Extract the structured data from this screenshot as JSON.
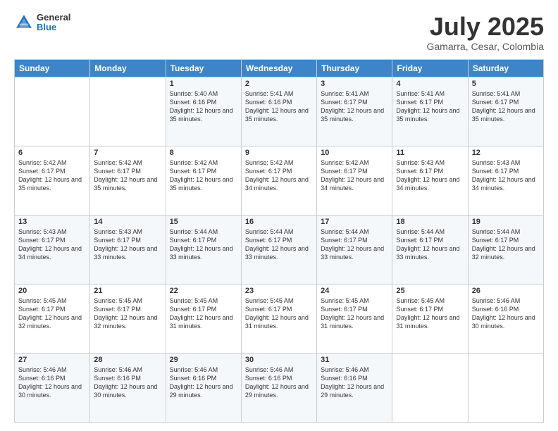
{
  "header": {
    "logo_general": "General",
    "logo_blue": "Blue",
    "month_title": "July 2025",
    "subtitle": "Gamarra, Cesar, Colombia"
  },
  "days_of_week": [
    "Sunday",
    "Monday",
    "Tuesday",
    "Wednesday",
    "Thursday",
    "Friday",
    "Saturday"
  ],
  "weeks": [
    [
      {
        "day": "",
        "sunrise": "",
        "sunset": "",
        "daylight": ""
      },
      {
        "day": "",
        "sunrise": "",
        "sunset": "",
        "daylight": ""
      },
      {
        "day": "1",
        "sunrise": "Sunrise: 5:40 AM",
        "sunset": "Sunset: 6:16 PM",
        "daylight": "Daylight: 12 hours and 35 minutes."
      },
      {
        "day": "2",
        "sunrise": "Sunrise: 5:41 AM",
        "sunset": "Sunset: 6:16 PM",
        "daylight": "Daylight: 12 hours and 35 minutes."
      },
      {
        "day": "3",
        "sunrise": "Sunrise: 5:41 AM",
        "sunset": "Sunset: 6:17 PM",
        "daylight": "Daylight: 12 hours and 35 minutes."
      },
      {
        "day": "4",
        "sunrise": "Sunrise: 5:41 AM",
        "sunset": "Sunset: 6:17 PM",
        "daylight": "Daylight: 12 hours and 35 minutes."
      },
      {
        "day": "5",
        "sunrise": "Sunrise: 5:41 AM",
        "sunset": "Sunset: 6:17 PM",
        "daylight": "Daylight: 12 hours and 35 minutes."
      }
    ],
    [
      {
        "day": "6",
        "sunrise": "Sunrise: 5:42 AM",
        "sunset": "Sunset: 6:17 PM",
        "daylight": "Daylight: 12 hours and 35 minutes."
      },
      {
        "day": "7",
        "sunrise": "Sunrise: 5:42 AM",
        "sunset": "Sunset: 6:17 PM",
        "daylight": "Daylight: 12 hours and 35 minutes."
      },
      {
        "day": "8",
        "sunrise": "Sunrise: 5:42 AM",
        "sunset": "Sunset: 6:17 PM",
        "daylight": "Daylight: 12 hours and 35 minutes."
      },
      {
        "day": "9",
        "sunrise": "Sunrise: 5:42 AM",
        "sunset": "Sunset: 6:17 PM",
        "daylight": "Daylight: 12 hours and 34 minutes."
      },
      {
        "day": "10",
        "sunrise": "Sunrise: 5:42 AM",
        "sunset": "Sunset: 6:17 PM",
        "daylight": "Daylight: 12 hours and 34 minutes."
      },
      {
        "day": "11",
        "sunrise": "Sunrise: 5:43 AM",
        "sunset": "Sunset: 6:17 PM",
        "daylight": "Daylight: 12 hours and 34 minutes."
      },
      {
        "day": "12",
        "sunrise": "Sunrise: 5:43 AM",
        "sunset": "Sunset: 6:17 PM",
        "daylight": "Daylight: 12 hours and 34 minutes."
      }
    ],
    [
      {
        "day": "13",
        "sunrise": "Sunrise: 5:43 AM",
        "sunset": "Sunset: 6:17 PM",
        "daylight": "Daylight: 12 hours and 34 minutes."
      },
      {
        "day": "14",
        "sunrise": "Sunrise: 5:43 AM",
        "sunset": "Sunset: 6:17 PM",
        "daylight": "Daylight: 12 hours and 33 minutes."
      },
      {
        "day": "15",
        "sunrise": "Sunrise: 5:44 AM",
        "sunset": "Sunset: 6:17 PM",
        "daylight": "Daylight: 12 hours and 33 minutes."
      },
      {
        "day": "16",
        "sunrise": "Sunrise: 5:44 AM",
        "sunset": "Sunset: 6:17 PM",
        "daylight": "Daylight: 12 hours and 33 minutes."
      },
      {
        "day": "17",
        "sunrise": "Sunrise: 5:44 AM",
        "sunset": "Sunset: 6:17 PM",
        "daylight": "Daylight: 12 hours and 33 minutes."
      },
      {
        "day": "18",
        "sunrise": "Sunrise: 5:44 AM",
        "sunset": "Sunset: 6:17 PM",
        "daylight": "Daylight: 12 hours and 33 minutes."
      },
      {
        "day": "19",
        "sunrise": "Sunrise: 5:44 AM",
        "sunset": "Sunset: 6:17 PM",
        "daylight": "Daylight: 12 hours and 32 minutes."
      }
    ],
    [
      {
        "day": "20",
        "sunrise": "Sunrise: 5:45 AM",
        "sunset": "Sunset: 6:17 PM",
        "daylight": "Daylight: 12 hours and 32 minutes."
      },
      {
        "day": "21",
        "sunrise": "Sunrise: 5:45 AM",
        "sunset": "Sunset: 6:17 PM",
        "daylight": "Daylight: 12 hours and 32 minutes."
      },
      {
        "day": "22",
        "sunrise": "Sunrise: 5:45 AM",
        "sunset": "Sunset: 6:17 PM",
        "daylight": "Daylight: 12 hours and 31 minutes."
      },
      {
        "day": "23",
        "sunrise": "Sunrise: 5:45 AM",
        "sunset": "Sunset: 6:17 PM",
        "daylight": "Daylight: 12 hours and 31 minutes."
      },
      {
        "day": "24",
        "sunrise": "Sunrise: 5:45 AM",
        "sunset": "Sunset: 6:17 PM",
        "daylight": "Daylight: 12 hours and 31 minutes."
      },
      {
        "day": "25",
        "sunrise": "Sunrise: 5:45 AM",
        "sunset": "Sunset: 6:17 PM",
        "daylight": "Daylight: 12 hours and 31 minutes."
      },
      {
        "day": "26",
        "sunrise": "Sunrise: 5:46 AM",
        "sunset": "Sunset: 6:16 PM",
        "daylight": "Daylight: 12 hours and 30 minutes."
      }
    ],
    [
      {
        "day": "27",
        "sunrise": "Sunrise: 5:46 AM",
        "sunset": "Sunset: 6:16 PM",
        "daylight": "Daylight: 12 hours and 30 minutes."
      },
      {
        "day": "28",
        "sunrise": "Sunrise: 5:46 AM",
        "sunset": "Sunset: 6:16 PM",
        "daylight": "Daylight: 12 hours and 30 minutes."
      },
      {
        "day": "29",
        "sunrise": "Sunrise: 5:46 AM",
        "sunset": "Sunset: 6:16 PM",
        "daylight": "Daylight: 12 hours and 29 minutes."
      },
      {
        "day": "30",
        "sunrise": "Sunrise: 5:46 AM",
        "sunset": "Sunset: 6:16 PM",
        "daylight": "Daylight: 12 hours and 29 minutes."
      },
      {
        "day": "31",
        "sunrise": "Sunrise: 5:46 AM",
        "sunset": "Sunset: 6:16 PM",
        "daylight": "Daylight: 12 hours and 29 minutes."
      },
      {
        "day": "",
        "sunrise": "",
        "sunset": "",
        "daylight": ""
      },
      {
        "day": "",
        "sunrise": "",
        "sunset": "",
        "daylight": ""
      }
    ]
  ]
}
